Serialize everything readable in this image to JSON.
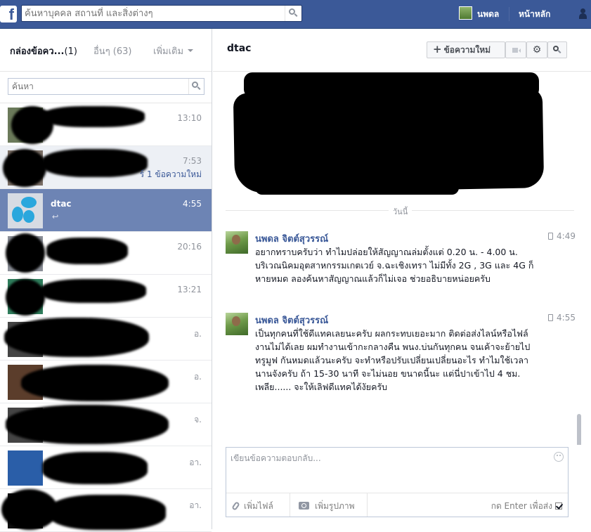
{
  "topbar": {
    "logo": "f",
    "search_placeholder": "ค้นหาบุคคล สถานที่ และสิ่งต่างๆ",
    "user_name": "นพดล",
    "home_label": "หน้าหลัก",
    "brand_color": "#3b5998"
  },
  "left": {
    "inbox_label": "กล่องข้อคว...",
    "inbox_count": "(1)",
    "other_label": "อื่นๆ (63)",
    "more_label": "เพิ่มเติม",
    "search_placeholder": "ค้นหา",
    "conversations": [
      {
        "time": "13:10"
      },
      {
        "time": "7:53",
        "unread_text": "ร์ 1 ข้อความใหม่"
      },
      {
        "name": "dtac",
        "time": "4:55",
        "selected": true
      },
      {
        "time": "20:16"
      },
      {
        "time": "13:21"
      },
      {
        "time": "อ."
      },
      {
        "time": "อ."
      },
      {
        "time": "จ."
      },
      {
        "time": "อา."
      },
      {
        "time": "อา."
      }
    ]
  },
  "thread": {
    "title": "dtac",
    "new_message_label": "ข้อความใหม่",
    "day_label": "วันนี้",
    "messages": [
      {
        "author": "นพดล จิตต์สุวรรณ์",
        "time": "4:49",
        "body": "อยากทราบครับว่า ทำไมปล่อยให้สัญญาณล่มตั้งแต่ 0.20 น. - 4.00 น.  บริเวณนิคมอุตสาหกรรมเกตเวย์ จ.ฉะเชิงเทรา ไม่มีทั้ง 2G , 3G และ 4G  ก็หายหมด  ลองค้นหาสัญญาณแล้วก็ไม่เจอ ช่วยอธิบายหน่อยครับ"
      },
      {
        "author": "นพดล จิตต์สุวรรณ์",
        "time": "4:55",
        "body": "เป็นทุกคนที่ใช้ดีแทคเลยนะครับ ผลกระทบเยอะมาก ติดต่อส่งไลน์หรือไฟล์งานไม่ได้เลย ผมทำงานเข้ากะกลางคืน พนง.บ่นกันทุกคน จนเค้าจะย้ายไปทรูมูฟ กันหมดแล้วนะครับ   จะทำหรือปรับเปลี่ยนเปลี่ยนอะไร ทำไมใช้เวลานานจังครับ ถ้า 15-30 นาที จะไม่นอย ขนาดนี้นะ แต่นี่ปาเข้าไป 4 ชม. เพลีย......   จะให้เลิฟดีแทคได้งัยครับ"
      }
    ]
  },
  "composer": {
    "placeholder": "เขียนข้อความตอบกลับ...",
    "attach_label": "เพิ่มไฟล์",
    "photo_label": "เพิ่มรูปภาพ",
    "enter_label": "กด Enter เพื่อส่ง"
  }
}
